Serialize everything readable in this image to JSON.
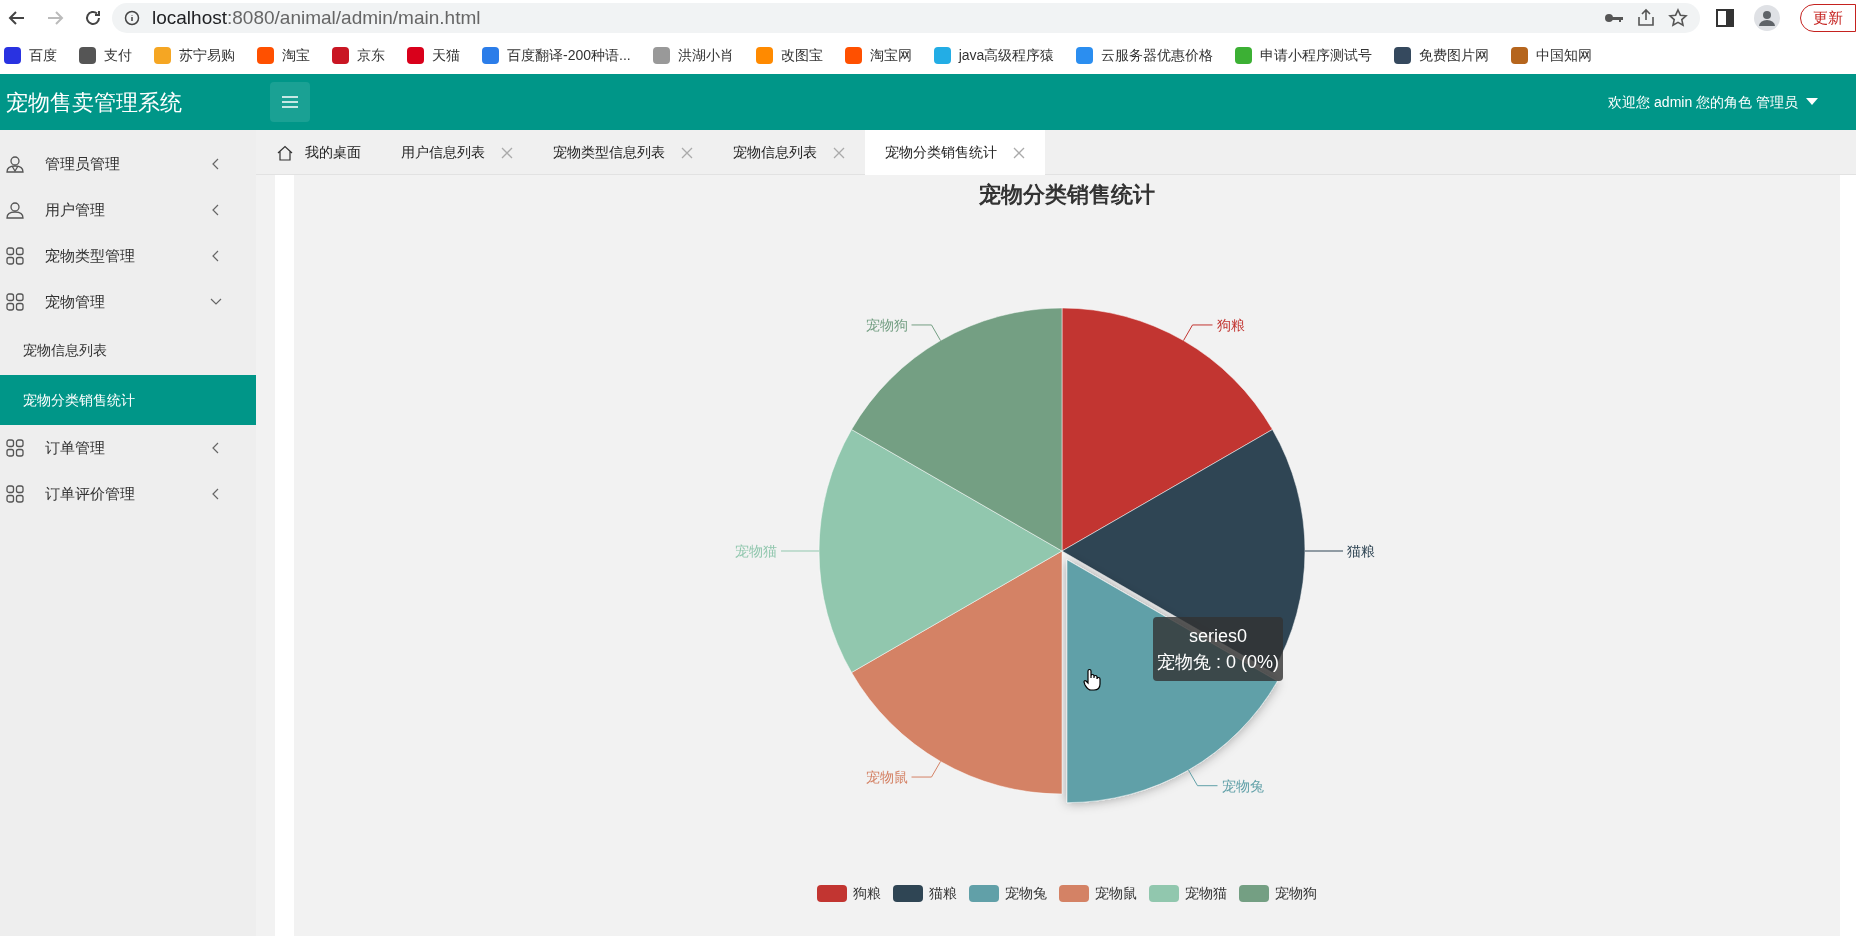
{
  "browser": {
    "url_host": "localhost",
    "url_rest": ":8080/animal/admin/main.html",
    "update_button": "更新",
    "bookmarks": [
      {
        "label": "百度",
        "color": "#2932e1"
      },
      {
        "label": "支付",
        "color": "#555555"
      },
      {
        "label": "苏宁易购",
        "color": "#f5a623"
      },
      {
        "label": "淘宝",
        "color": "#ff5000"
      },
      {
        "label": "京东",
        "color": "#c91623"
      },
      {
        "label": "天猫",
        "color": "#d9001b"
      },
      {
        "label": "百度翻译-200种语...",
        "color": "#2b7de9"
      },
      {
        "label": "洪湖小肖",
        "color": "#999999"
      },
      {
        "label": "改图宝",
        "color": "#ff8a00"
      },
      {
        "label": "淘宝网",
        "color": "#ff5000"
      },
      {
        "label": "java高级程序猿",
        "color": "#23ade5"
      },
      {
        "label": "云服务器优惠价格",
        "color": "#2b8ef0"
      },
      {
        "label": "申请小程序测试号",
        "color": "#3cb034"
      },
      {
        "label": "免费图片网",
        "color": "#35495e"
      },
      {
        "label": "中国知网",
        "color": "#b5651d"
      }
    ]
  },
  "header": {
    "title": "宠物售卖管理系统",
    "user_info": "欢迎您 admin 您的角色 管理员"
  },
  "sidebar": {
    "items": [
      {
        "label": "管理员管理",
        "kind": "admin",
        "expanded": false
      },
      {
        "label": "用户管理",
        "kind": "user",
        "expanded": false
      },
      {
        "label": "宠物类型管理",
        "kind": "grid",
        "expanded": false
      },
      {
        "label": "宠物管理",
        "kind": "grid",
        "expanded": true,
        "children": [
          {
            "label": "宠物信息列表",
            "selected": false
          },
          {
            "label": "宠物分类销售统计",
            "selected": true
          }
        ]
      },
      {
        "label": "订单管理",
        "kind": "grid",
        "expanded": false
      },
      {
        "label": "订单评价管理",
        "kind": "grid",
        "expanded": false
      }
    ]
  },
  "tabs": [
    {
      "label": "我的桌面",
      "kind": "home",
      "selected": false
    },
    {
      "label": "用户信息列表",
      "kind": "closable",
      "selected": false
    },
    {
      "label": "宠物类型信息列表",
      "kind": "closable",
      "selected": false
    },
    {
      "label": "宠物信息列表",
      "kind": "closable",
      "selected": false
    },
    {
      "label": "宠物分类销售统计",
      "kind": "closable",
      "selected": true
    }
  ],
  "chart": {
    "title": "宠物分类销售统计",
    "slices": [
      {
        "label": "狗粮",
        "color": "#c23531",
        "hovered": false
      },
      {
        "label": "猫粮",
        "color": "#2f4554",
        "hovered": false
      },
      {
        "label": "宠物兔",
        "color": "#61a0a8",
        "hovered": true
      },
      {
        "label": "宠物鼠",
        "color": "#d48265",
        "hovered": false
      },
      {
        "label": "宠物猫",
        "color": "#91c7ae",
        "hovered": false
      },
      {
        "label": "宠物狗",
        "color": "#749f83",
        "hovered": false
      }
    ],
    "legend": [
      {
        "label": "狗粮",
        "color": "#c23531"
      },
      {
        "label": "猫粮",
        "color": "#2f4554"
      },
      {
        "label": "宠物兔",
        "color": "#61a0a8"
      },
      {
        "label": "宠物鼠",
        "color": "#d48265"
      },
      {
        "label": "宠物猫",
        "color": "#91c7ae"
      },
      {
        "label": "宠物狗",
        "color": "#749f83"
      }
    ],
    "tooltip": {
      "title": "series0",
      "text": "宠物兔 : 0 (0%)"
    }
  }
}
